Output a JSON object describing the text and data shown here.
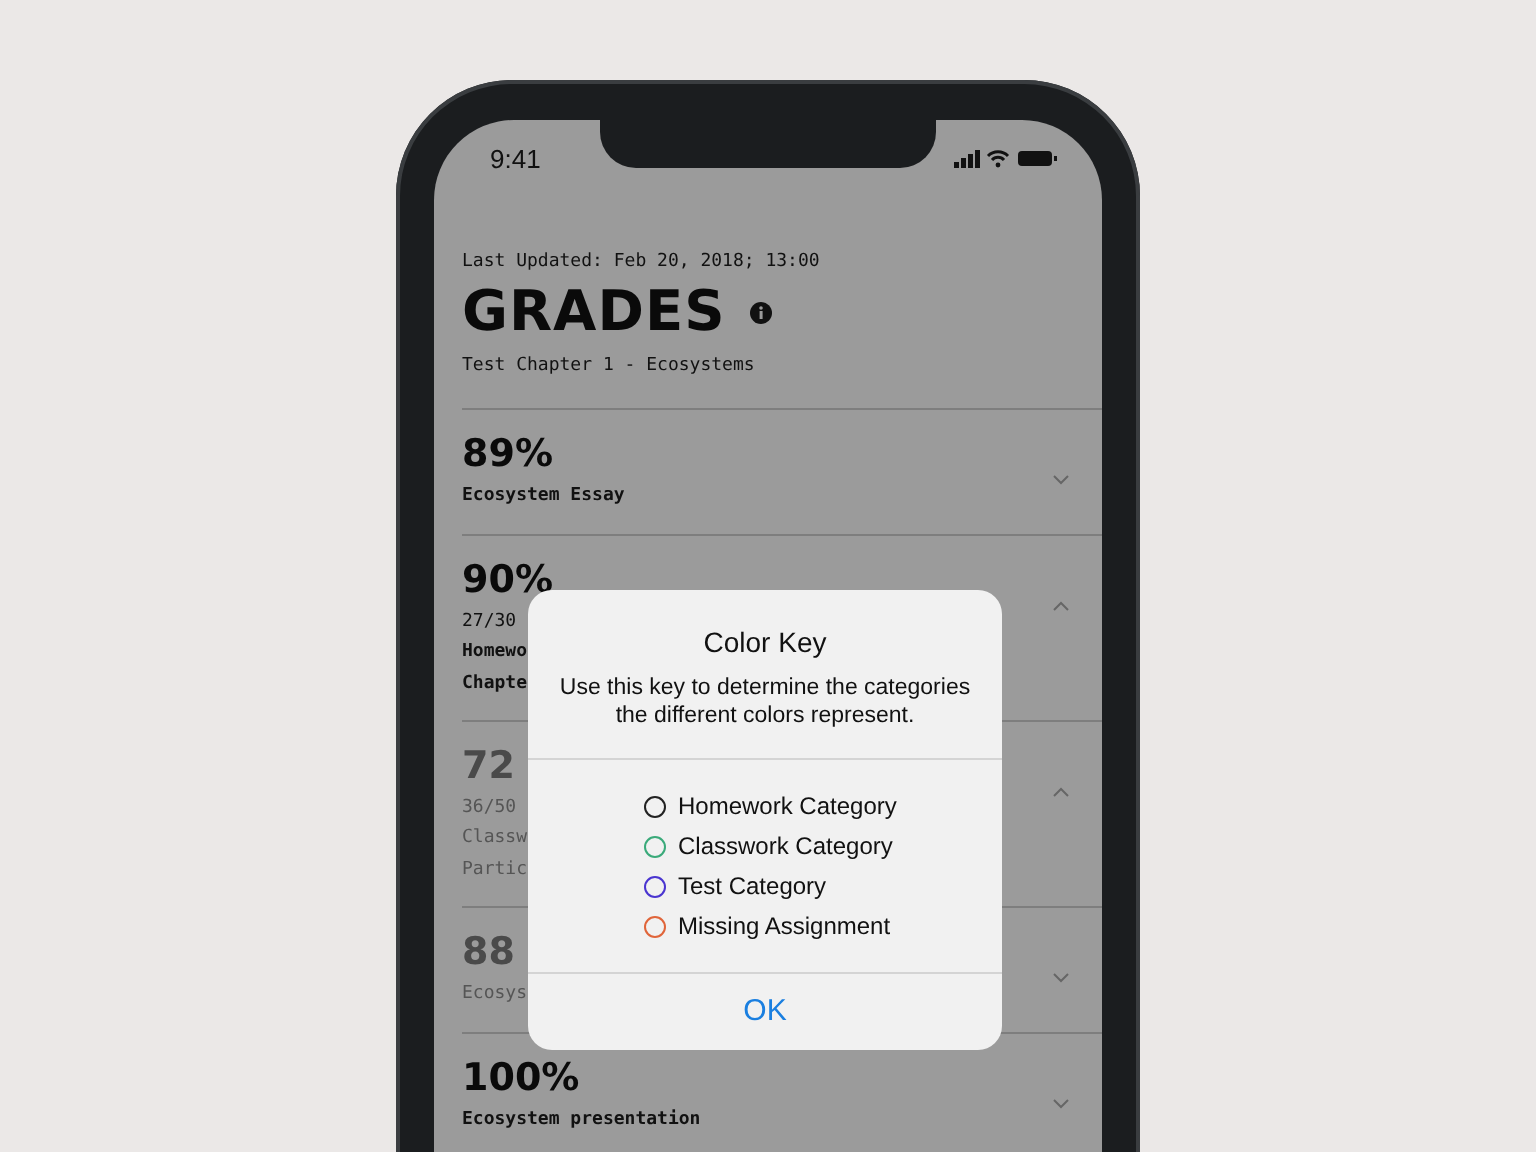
{
  "status_bar": {
    "time": "9:41"
  },
  "header": {
    "updated": "Last Updated: Feb 20, 2018; 13:00",
    "title": "GRADES",
    "subtitle": "Test Chapter 1 - Ecosystems"
  },
  "grades": [
    {
      "score": "89%",
      "lines": [
        "Ecosystem Essay"
      ],
      "expanded": false,
      "muted": false
    },
    {
      "score": "90%",
      "lines": [
        "27/30",
        "Homewo",
        "Chapte"
      ],
      "expanded": true,
      "muted": false
    },
    {
      "score": "72",
      "lines": [
        "36/50",
        "Classw",
        "Partic"
      ],
      "expanded": true,
      "muted": true
    },
    {
      "score": "88",
      "lines": [
        "Ecosys"
      ],
      "expanded": false,
      "muted": true
    },
    {
      "score": "100%",
      "lines": [
        "Ecosystem presentation"
      ],
      "expanded": false,
      "muted": false
    }
  ],
  "dialog": {
    "title": "Color Key",
    "message": "Use this key to determine the categories the different colors represent.",
    "categories": [
      {
        "label": "Homework Category",
        "color": "#222222"
      },
      {
        "label": "Classwork Category",
        "color": "#3aaa7a"
      },
      {
        "label": "Test Category",
        "color": "#4a35d0"
      },
      {
        "label": "Missing Assignment",
        "color": "#e0653a"
      }
    ],
    "button": "OK"
  }
}
